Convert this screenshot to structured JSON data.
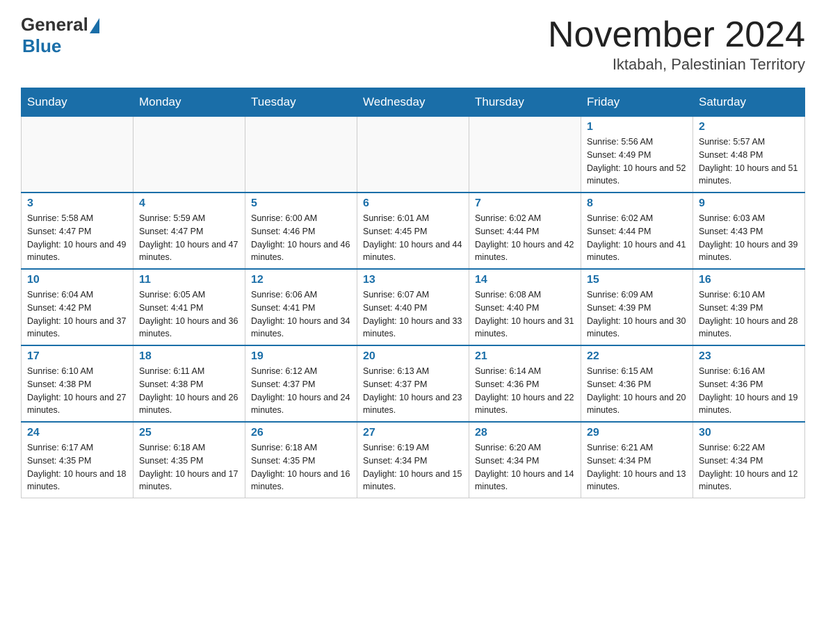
{
  "header": {
    "logo_general": "General",
    "logo_blue": "Blue",
    "month_title": "November 2024",
    "location": "Iktabah, Palestinian Territory"
  },
  "weekdays": [
    "Sunday",
    "Monday",
    "Tuesday",
    "Wednesday",
    "Thursday",
    "Friday",
    "Saturday"
  ],
  "weeks": [
    [
      {
        "day": "",
        "info": ""
      },
      {
        "day": "",
        "info": ""
      },
      {
        "day": "",
        "info": ""
      },
      {
        "day": "",
        "info": ""
      },
      {
        "day": "",
        "info": ""
      },
      {
        "day": "1",
        "info": "Sunrise: 5:56 AM\nSunset: 4:49 PM\nDaylight: 10 hours and 52 minutes."
      },
      {
        "day": "2",
        "info": "Sunrise: 5:57 AM\nSunset: 4:48 PM\nDaylight: 10 hours and 51 minutes."
      }
    ],
    [
      {
        "day": "3",
        "info": "Sunrise: 5:58 AM\nSunset: 4:47 PM\nDaylight: 10 hours and 49 minutes."
      },
      {
        "day": "4",
        "info": "Sunrise: 5:59 AM\nSunset: 4:47 PM\nDaylight: 10 hours and 47 minutes."
      },
      {
        "day": "5",
        "info": "Sunrise: 6:00 AM\nSunset: 4:46 PM\nDaylight: 10 hours and 46 minutes."
      },
      {
        "day": "6",
        "info": "Sunrise: 6:01 AM\nSunset: 4:45 PM\nDaylight: 10 hours and 44 minutes."
      },
      {
        "day": "7",
        "info": "Sunrise: 6:02 AM\nSunset: 4:44 PM\nDaylight: 10 hours and 42 minutes."
      },
      {
        "day": "8",
        "info": "Sunrise: 6:02 AM\nSunset: 4:44 PM\nDaylight: 10 hours and 41 minutes."
      },
      {
        "day": "9",
        "info": "Sunrise: 6:03 AM\nSunset: 4:43 PM\nDaylight: 10 hours and 39 minutes."
      }
    ],
    [
      {
        "day": "10",
        "info": "Sunrise: 6:04 AM\nSunset: 4:42 PM\nDaylight: 10 hours and 37 minutes."
      },
      {
        "day": "11",
        "info": "Sunrise: 6:05 AM\nSunset: 4:41 PM\nDaylight: 10 hours and 36 minutes."
      },
      {
        "day": "12",
        "info": "Sunrise: 6:06 AM\nSunset: 4:41 PM\nDaylight: 10 hours and 34 minutes."
      },
      {
        "day": "13",
        "info": "Sunrise: 6:07 AM\nSunset: 4:40 PM\nDaylight: 10 hours and 33 minutes."
      },
      {
        "day": "14",
        "info": "Sunrise: 6:08 AM\nSunset: 4:40 PM\nDaylight: 10 hours and 31 minutes."
      },
      {
        "day": "15",
        "info": "Sunrise: 6:09 AM\nSunset: 4:39 PM\nDaylight: 10 hours and 30 minutes."
      },
      {
        "day": "16",
        "info": "Sunrise: 6:10 AM\nSunset: 4:39 PM\nDaylight: 10 hours and 28 minutes."
      }
    ],
    [
      {
        "day": "17",
        "info": "Sunrise: 6:10 AM\nSunset: 4:38 PM\nDaylight: 10 hours and 27 minutes."
      },
      {
        "day": "18",
        "info": "Sunrise: 6:11 AM\nSunset: 4:38 PM\nDaylight: 10 hours and 26 minutes."
      },
      {
        "day": "19",
        "info": "Sunrise: 6:12 AM\nSunset: 4:37 PM\nDaylight: 10 hours and 24 minutes."
      },
      {
        "day": "20",
        "info": "Sunrise: 6:13 AM\nSunset: 4:37 PM\nDaylight: 10 hours and 23 minutes."
      },
      {
        "day": "21",
        "info": "Sunrise: 6:14 AM\nSunset: 4:36 PM\nDaylight: 10 hours and 22 minutes."
      },
      {
        "day": "22",
        "info": "Sunrise: 6:15 AM\nSunset: 4:36 PM\nDaylight: 10 hours and 20 minutes."
      },
      {
        "day": "23",
        "info": "Sunrise: 6:16 AM\nSunset: 4:36 PM\nDaylight: 10 hours and 19 minutes."
      }
    ],
    [
      {
        "day": "24",
        "info": "Sunrise: 6:17 AM\nSunset: 4:35 PM\nDaylight: 10 hours and 18 minutes."
      },
      {
        "day": "25",
        "info": "Sunrise: 6:18 AM\nSunset: 4:35 PM\nDaylight: 10 hours and 17 minutes."
      },
      {
        "day": "26",
        "info": "Sunrise: 6:18 AM\nSunset: 4:35 PM\nDaylight: 10 hours and 16 minutes."
      },
      {
        "day": "27",
        "info": "Sunrise: 6:19 AM\nSunset: 4:34 PM\nDaylight: 10 hours and 15 minutes."
      },
      {
        "day": "28",
        "info": "Sunrise: 6:20 AM\nSunset: 4:34 PM\nDaylight: 10 hours and 14 minutes."
      },
      {
        "day": "29",
        "info": "Sunrise: 6:21 AM\nSunset: 4:34 PM\nDaylight: 10 hours and 13 minutes."
      },
      {
        "day": "30",
        "info": "Sunrise: 6:22 AM\nSunset: 4:34 PM\nDaylight: 10 hours and 12 minutes."
      }
    ]
  ]
}
